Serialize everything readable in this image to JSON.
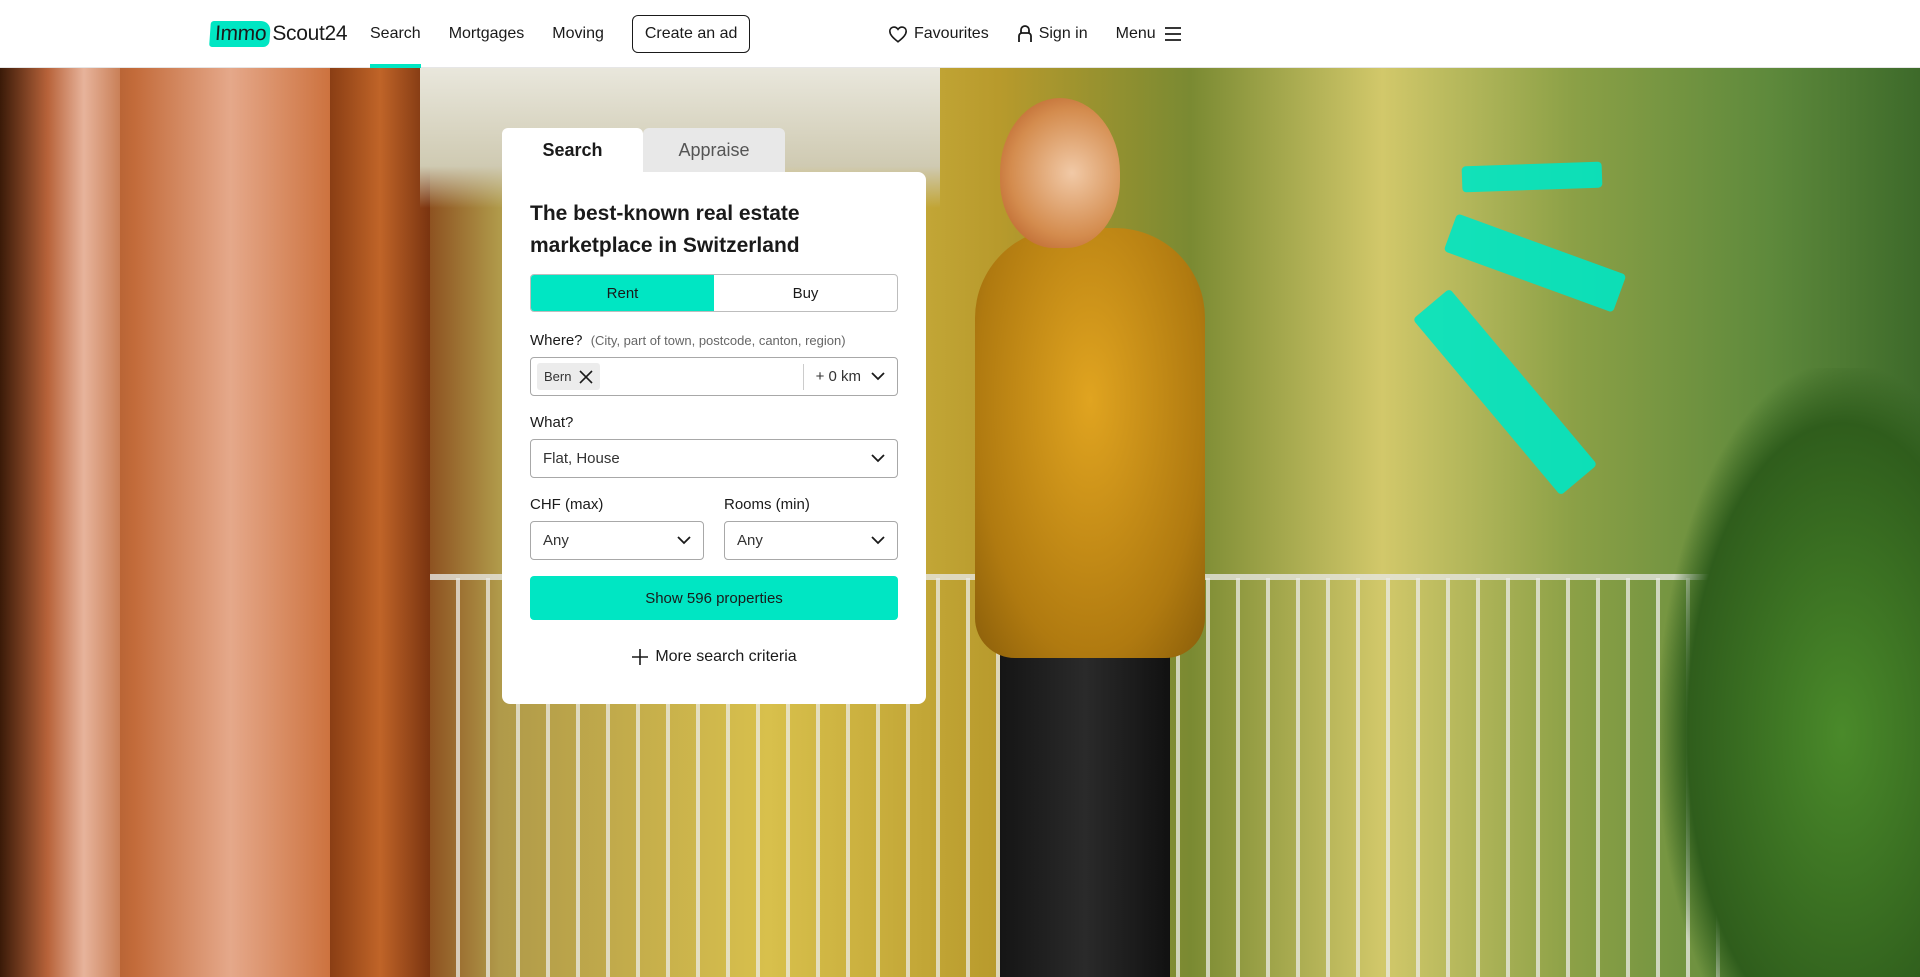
{
  "header": {
    "logo": {
      "part1": "Immo",
      "part2": "Scout24"
    },
    "nav": [
      "Search",
      "Mortgages",
      "Moving"
    ],
    "create_ad": "Create an ad",
    "favourites": "Favourites",
    "sign_in": "Sign in",
    "menu": "Menu"
  },
  "search_card": {
    "tabs": [
      "Search",
      "Appraise"
    ],
    "title": "The best-known real estate marketplace in Switzerland",
    "toggle": {
      "rent": "Rent",
      "buy": "Buy",
      "selected": "Rent"
    },
    "where": {
      "label": "Where?",
      "hint": "(City, part of town, postcode, canton, region)",
      "chip": "Bern",
      "radius": "+ 0 km"
    },
    "what": {
      "label": "What?",
      "value": "Flat, House"
    },
    "price": {
      "label": "CHF (max)",
      "value": "Any"
    },
    "rooms": {
      "label": "Rooms (min)",
      "value": "Any"
    },
    "cta": "Show 596 properties",
    "more": "More search criteria"
  },
  "colors": {
    "accent": "#00e6c3",
    "text": "#1a1a1a"
  },
  "icons": [
    "heart-icon",
    "user-icon",
    "hamburger-icon",
    "close-icon",
    "chevron-down-icon",
    "plus-icon"
  ]
}
